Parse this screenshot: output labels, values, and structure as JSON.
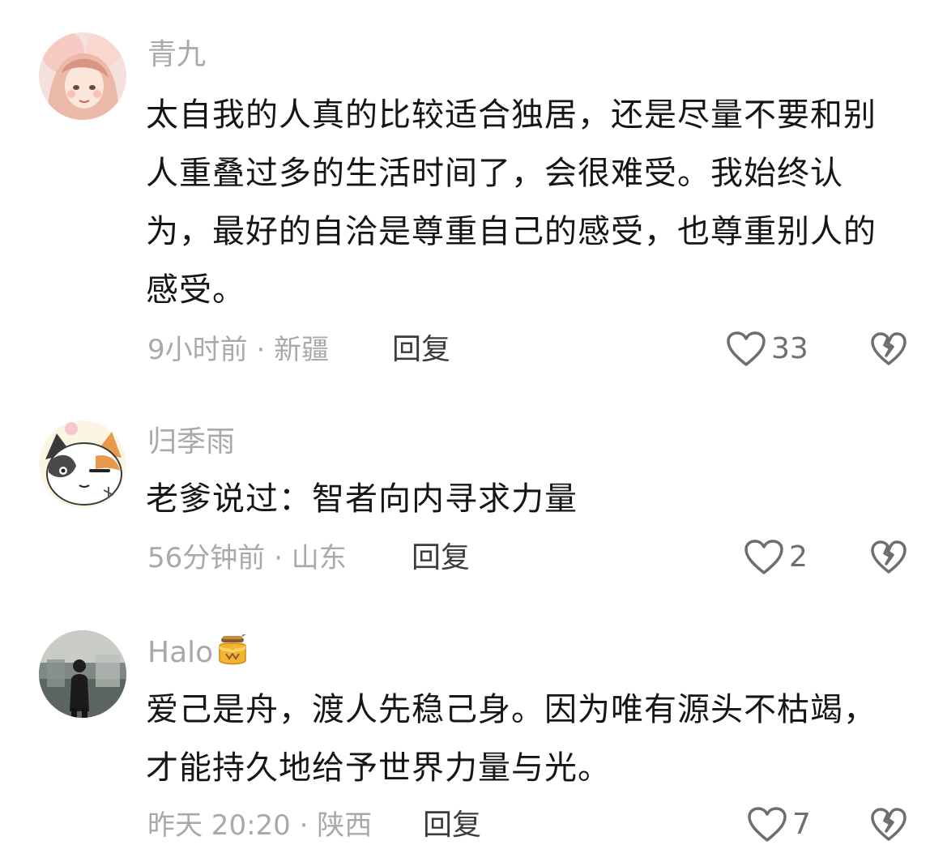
{
  "comments": [
    {
      "username": "青九",
      "text": "太自我的人真的比较适合独居，还是尽量不要和别人重叠过多的生活时间了，会很难受。我始终认为，最好的自洽是尊重自己的感受，也尊重别人的感受。",
      "time": "9小时前",
      "location": "新疆",
      "reply_label": "回复",
      "likes": "33",
      "avatar_icon": "avatar-illustrated-girl"
    },
    {
      "username": "归季雨",
      "text": "老爹说过：智者向内寻求力量",
      "time": "56分钟前",
      "location": "山东",
      "reply_label": "回复",
      "likes": "2",
      "avatar_icon": "avatar-cartoon-cat"
    },
    {
      "username": "Halo",
      "username_emoji": "honey-pot-icon",
      "text": "爱己是舟，渡人先稳己身。因为唯有源头不枯竭，才能持久地给予世界力量与光。",
      "time": "昨天 20:20",
      "location": "陕西",
      "reply_label": "回复",
      "likes": "7",
      "avatar_icon": "avatar-photo-person"
    }
  ],
  "separator": "·",
  "colors": {
    "text": "#161616",
    "muted": "#a9a9ad",
    "reply": "#3c3c3c",
    "icon": "#6e6e72"
  }
}
